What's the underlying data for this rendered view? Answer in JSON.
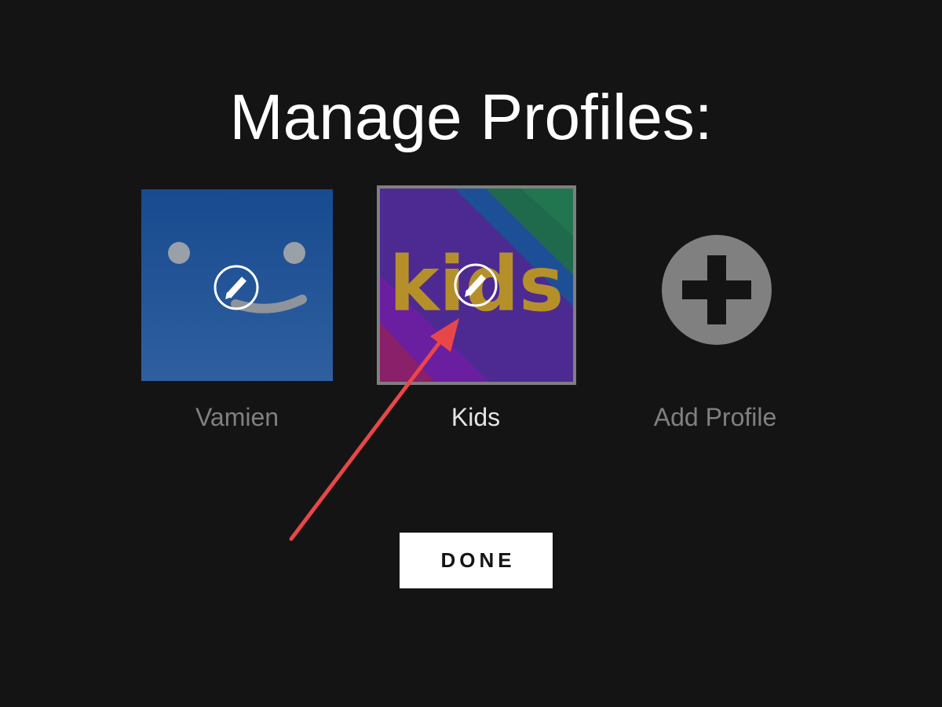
{
  "page": {
    "title": "Manage Profiles:"
  },
  "profiles": [
    {
      "name": "Vamien",
      "avatar": "smiley-face-blue",
      "edit_icon": "pencil-icon"
    },
    {
      "name": "Kids",
      "avatar": "kids-logo",
      "avatar_text": "kids",
      "edit_icon": "pencil-icon",
      "state": "hovered"
    },
    {
      "name": "Add Profile",
      "icon": "plus-circle-icon"
    }
  ],
  "done_button": {
    "label": "DONE"
  },
  "annotation": {
    "type": "red-arrow",
    "color": "#e8474a",
    "points_to": "Kids edit icon"
  },
  "colors": {
    "background": "#141414",
    "title": "#ffffff",
    "inactive_label": "#808080",
    "active_label": "#e5e5e5",
    "done_bg": "#ffffff",
    "vamien_avatar": "#1f4e92",
    "kids_border": "#7f7f7f",
    "kids_text": "#b5902a"
  }
}
